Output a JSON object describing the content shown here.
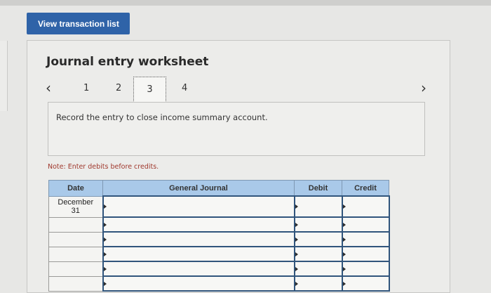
{
  "toolbar": {
    "view_transaction_list_label": "View transaction list"
  },
  "worksheet": {
    "title": "Journal entry worksheet",
    "pager": {
      "prev_icon": "chevron-left-icon",
      "next_icon": "chevron-right-icon",
      "pages": [
        "1",
        "2",
        "3",
        "4"
      ],
      "active_page": "3"
    },
    "instruction": "Record the entry to close income summary account.",
    "note": "Note: Enter debits before credits."
  },
  "journal_table": {
    "columns": [
      "Date",
      "General Journal",
      "Debit",
      "Credit"
    ],
    "first_date": "December\n31"
  },
  "colors": {
    "button_bg": "#2f63a8",
    "header_bg": "#a9c9e9",
    "note_red": "#a0382d",
    "entry_border": "#31557c"
  }
}
